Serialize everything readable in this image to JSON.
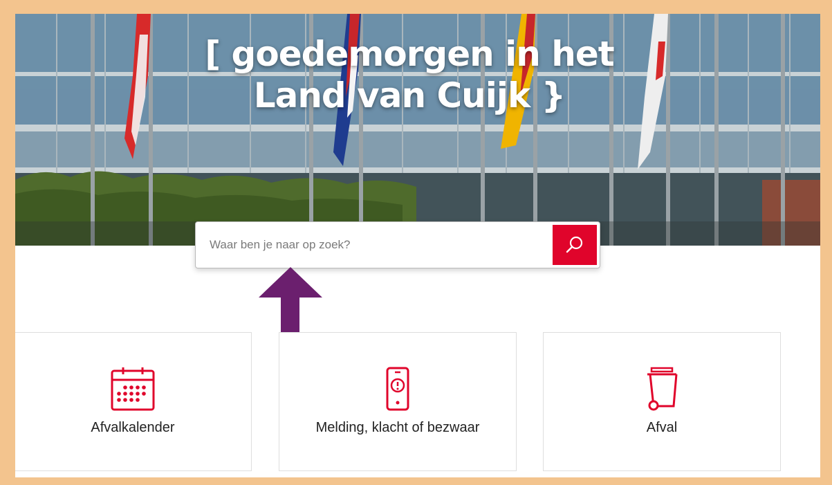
{
  "hero": {
    "title_line1": "[ goedemorgen in het",
    "title_line2": "Land van Cuijk }"
  },
  "search": {
    "placeholder": "Waar ben je naar op zoek?",
    "value": "",
    "button_icon": "search-icon"
  },
  "annotation": {
    "arrow_color": "#6b1f6e",
    "arrow_icon": "up-arrow-icon"
  },
  "cards": [
    {
      "label": "Afvalkalender",
      "icon": "calendar-icon"
    },
    {
      "label": "Melding, klacht of bezwaar",
      "icon": "phone-alert-icon"
    },
    {
      "label": "Afval",
      "icon": "waste-bin-icon"
    }
  ],
  "colors": {
    "accent": "#e0042b",
    "frame_border": "#f3c48e",
    "arrow": "#6b1f6e"
  }
}
